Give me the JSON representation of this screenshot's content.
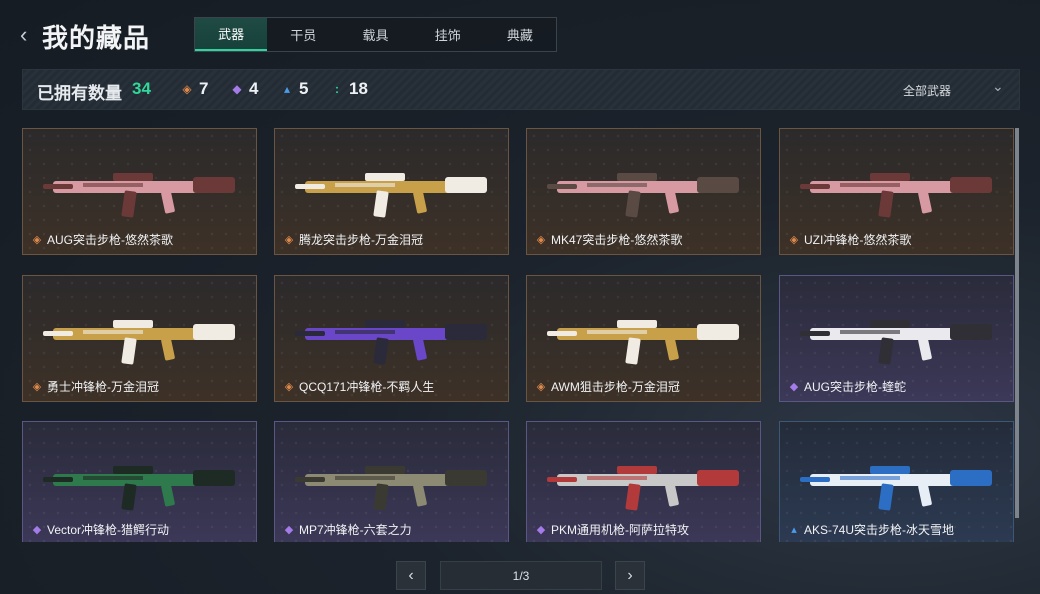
{
  "header": {
    "back_icon": "chevron-left-icon",
    "title": "我的藏品",
    "tabs": [
      {
        "label": "武器",
        "active": true
      },
      {
        "label": "干员",
        "active": false
      },
      {
        "label": "载具",
        "active": false
      },
      {
        "label": "挂饰",
        "active": false
      },
      {
        "label": "典藏",
        "active": false
      }
    ]
  },
  "stats": {
    "owned_label": "已拥有数量",
    "owned_count": "34",
    "rarity_counts": [
      {
        "icon": "orange-diamond-icon",
        "color": "#e08a4a",
        "value": "7"
      },
      {
        "icon": "purple-diamond-icon",
        "color": "#a47be8",
        "value": "4"
      },
      {
        "icon": "blue-triangle-icon",
        "color": "#4b9bea",
        "value": "5"
      },
      {
        "icon": "teal-dots-icon",
        "color": "#2fd3a0",
        "value": "18"
      }
    ],
    "filter_label": "全部武器",
    "filter_icon": "chevron-down-icon"
  },
  "items": [
    {
      "name": "AUG突击步枪-悠然茶歌",
      "rarity": "orange"
    },
    {
      "name": "腾龙突击步枪-万金泪冠",
      "rarity": "orange"
    },
    {
      "name": "MK47突击步枪-悠然茶歌",
      "rarity": "orange"
    },
    {
      "name": "UZI冲锋枪-悠然茶歌",
      "rarity": "orange"
    },
    {
      "name": "勇士冲锋枪-万金泪冠",
      "rarity": "orange"
    },
    {
      "name": "QCQ171冲锋枪-不羁人生",
      "rarity": "orange"
    },
    {
      "name": "AWM狙击步枪-万金泪冠",
      "rarity": "orange"
    },
    {
      "name": "AUG突击步枪-蝰蛇",
      "rarity": "purple"
    },
    {
      "name": "Vector冲锋枪-猎鳄行动",
      "rarity": "purple"
    },
    {
      "name": "MP7冲锋枪-六套之力",
      "rarity": "purple"
    },
    {
      "name": "PKM通用机枪-阿萨拉特攻",
      "rarity": "purple"
    },
    {
      "name": "AKS-74U突击步枪-冰天雪地",
      "rarity": "blue"
    }
  ],
  "colors": {
    "accent": "#2fd3a0",
    "orange": "#e08a4a",
    "purple": "#a47be8",
    "blue": "#4b9bea"
  },
  "pager": {
    "page_text": "1/3",
    "prev_icon": "chevron-left-icon",
    "next_icon": "chevron-right-icon"
  }
}
